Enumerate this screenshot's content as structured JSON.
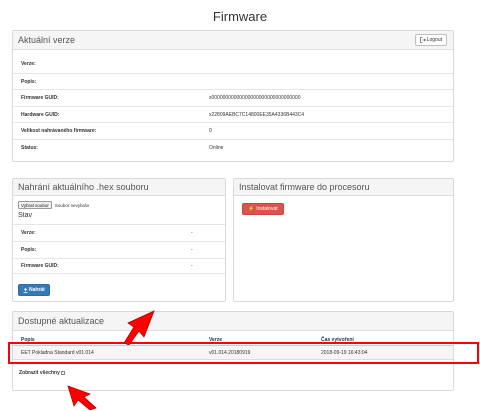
{
  "page": {
    "title": "Firmware"
  },
  "current_version": {
    "title": "Aktuální verze",
    "logout_label": "Logout",
    "rows": [
      {
        "label": "Verze:",
        "value": ""
      },
      {
        "label": "Popis:",
        "value": ""
      },
      {
        "label": "Firmware GUID:",
        "value": "x00000000000000000000000000000000"
      },
      {
        "label": "Hardware GUID:",
        "value": "x22809AEBC7C14800EE35A4336B443C4"
      },
      {
        "label": "Velikost nahrávaného firmware:",
        "value": "0"
      },
      {
        "label": "Status:",
        "value": "Online"
      }
    ]
  },
  "upload": {
    "title": "Nahrání aktuálního .hex souboru",
    "file_button_label": "Vybrat soubor",
    "file_status": "Soubor nevybrán",
    "stav_label": "Stav",
    "rows": [
      {
        "label": "Verze:",
        "value": "-"
      },
      {
        "label": "Popis:",
        "value": "-"
      },
      {
        "label": "Firmware GUID:",
        "value": "-"
      }
    ],
    "upload_button_label": "Nahrát"
  },
  "install": {
    "title": "Instalovat firmware do procesoru",
    "install_button_label": "Instalovat"
  },
  "updates": {
    "title": "Dostupné aktualizace",
    "columns": [
      "Popis",
      "Verze",
      "Čas vytvoření"
    ],
    "rows": [
      {
        "popis": "EET Pokladna Standard v01.014",
        "verze": "v01.014.20180919",
        "cas": "2018-09-19 16:43:04"
      }
    ],
    "show_all_label": "Zobrazit všechny"
  },
  "annotations": {
    "highlight_color": "#ff0000",
    "arrow_color": "#ff0000"
  }
}
